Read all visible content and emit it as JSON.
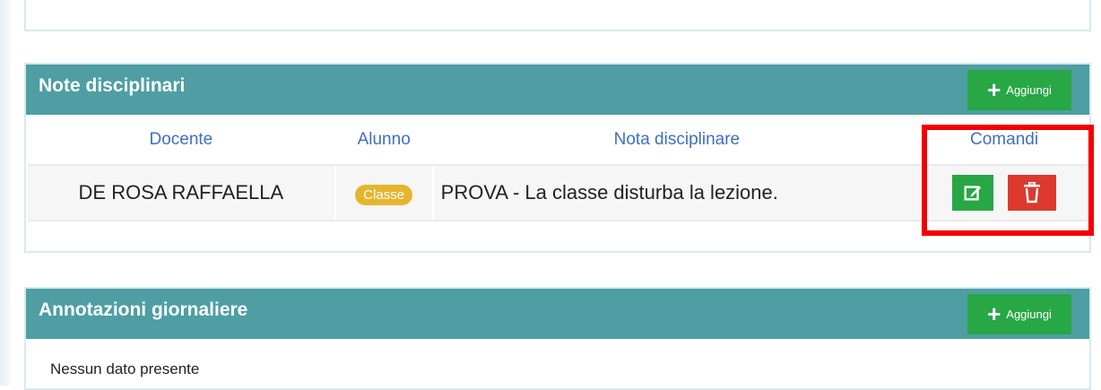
{
  "notes_panel": {
    "title": "Note disciplinari",
    "add_label": "Aggiungi",
    "columns": [
      "Docente",
      "Alunno",
      "Nota disciplinare",
      "Comandi"
    ],
    "rows": [
      {
        "docente": "DE ROSA RAFFAELLA",
        "alunno_badge": "Classe",
        "nota": "PROVA - La classe disturba la lezione."
      }
    ]
  },
  "annotations_panel": {
    "title": "Annotazioni giornaliere",
    "add_label": "Aggiungi",
    "empty_text": "Nessun dato presente"
  },
  "colors": {
    "header_teal": "#4e9ea4",
    "add_green": "#28a745",
    "delete_red": "#dc3a2f",
    "badge_yellow": "#e6b52f",
    "column_header_blue": "#3e6fc0",
    "highlight_red": "#f20000"
  },
  "icons": {
    "add": "plus-icon",
    "edit": "edit-icon",
    "delete": "trash-icon"
  }
}
